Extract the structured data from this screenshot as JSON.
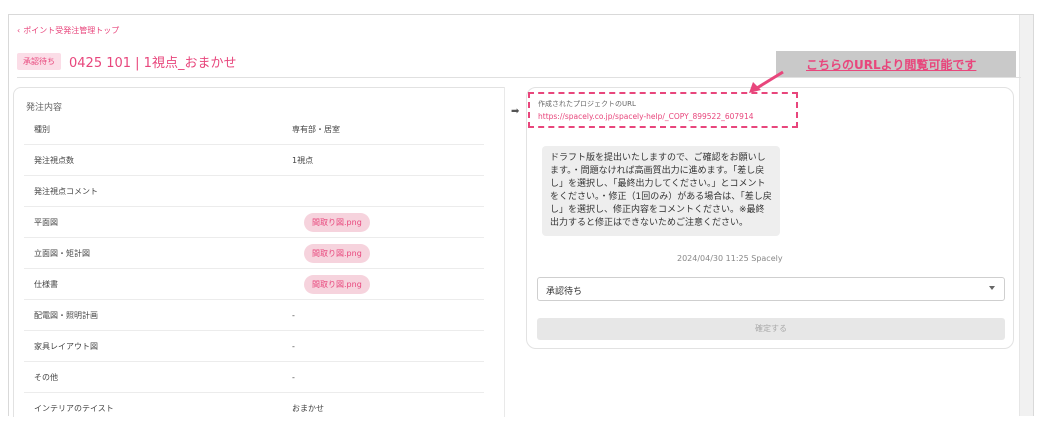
{
  "nav": {
    "back_label": "ポイント受発注管理トップ"
  },
  "header": {
    "status_badge": "承認待ち",
    "title": "0425 101 | 1視点_おまかせ"
  },
  "order": {
    "section_label": "発注内容",
    "rows": [
      {
        "label": "種別",
        "value": "専有部・居室"
      },
      {
        "label": "発注視点数",
        "value": "1視点"
      },
      {
        "label": "発注視点コメント",
        "value": ""
      },
      {
        "label": "平面図",
        "file": "間取り図.png"
      },
      {
        "label": "立面図・矩計図",
        "file": "間取り図.png"
      },
      {
        "label": "仕様書",
        "file": "間取り図.png"
      },
      {
        "label": "配電図・照明計画",
        "value": "-"
      },
      {
        "label": "家具レイアウト図",
        "value": "-"
      },
      {
        "label": "その他",
        "value": "-"
      },
      {
        "label": "インテリアのテイスト",
        "value": "おまかせ"
      }
    ]
  },
  "project": {
    "url_label": "作成されたプロジェクトのURL",
    "url": "https://spacely.co.jp/spacely-help/_COPY_899522_607914"
  },
  "message": {
    "text": "ドラフト版を提出いたしますので、ご確認をお願いします。・問題なければ高画質出力に進めます。「差し戻し」を選択し、「最終出力してください。」とコメントをください。・修正（1回のみ）がある場合は、「差し戻し」を選択し、修正内容をコメントください。※最終出力すると修正はできないためご注意ください。",
    "meta": "2024/04/30 11:25 Spacely"
  },
  "status_select": {
    "selected": "承認待ち"
  },
  "confirm_label": "確定する",
  "callout": {
    "text": "こちらのURLより閲覧可能です"
  },
  "colors": {
    "accent": "#e8467c",
    "callout_bg": "#c9c9c9"
  }
}
